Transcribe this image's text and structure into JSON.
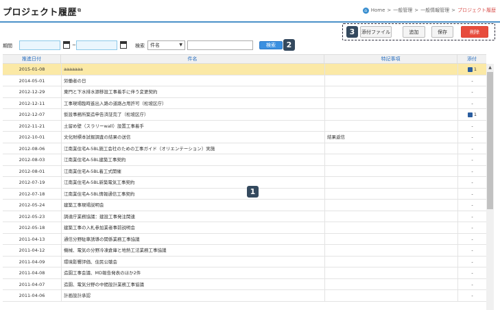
{
  "header": {
    "title": "プロジェクト履歴",
    "title_icon": "external-link-icon",
    "breadcrumb": {
      "home": "Home",
      "sep": ">",
      "items": [
        "一般管理",
        "一般情報管理"
      ],
      "current": "プロジェクト履歴"
    }
  },
  "toolbar": {
    "attach_label": "添付ファイル",
    "add_label": "追加",
    "save_label": "保存",
    "delete_label": "削除",
    "delete_color": "#e74c3c"
  },
  "badges": {
    "b1": "1",
    "b2": "2",
    "b3": "3"
  },
  "filter": {
    "period_label": "期間",
    "period_sep": "~",
    "search_label": "検索",
    "select_value": "件名",
    "search_button": "検索",
    "text_value": ""
  },
  "table": {
    "headers": [
      "推進日付",
      "件名",
      "特記事項",
      "添付"
    ],
    "rows": [
      {
        "date": "2015-01-08",
        "name": "aaaaaaa",
        "note": "",
        "att": "1",
        "selected": true
      },
      {
        "date": "2014-05-01",
        "name": "労働者の日",
        "note": "",
        "att": "-"
      },
      {
        "date": "2012-12-29",
        "name": "東門と下水排水源移設工事着手に伴う変更契約",
        "note": "",
        "att": "-"
      },
      {
        "date": "2012-12-11",
        "name": "工事現場臨時進出入路の道路占用許可（松坡区庁）",
        "note": "",
        "att": "-"
      },
      {
        "date": "2012-12-07",
        "name": "仮設事務所築造申告済証完了（松坡区庁）",
        "note": "",
        "att": "1"
      },
      {
        "date": "2012-11-21",
        "name": "土留め壁（スラリーwall）設置工事着手",
        "note": "",
        "att": "-"
      },
      {
        "date": "2012-10-01",
        "name": "文化財標本試掘調査の結果の送信",
        "note": "結果返信",
        "att": "-"
      },
      {
        "date": "2012-08-06",
        "name": "江南業住宅A-5BL施工会社のための工事ガイド（オリエンテーション）実施",
        "note": "",
        "att": "-"
      },
      {
        "date": "2012-08-03",
        "name": "江南業住宅A-5BL建築工事契約",
        "note": "",
        "att": "-"
      },
      {
        "date": "2012-08-01",
        "name": "江南業住宅A-5BL着工式開催",
        "note": "",
        "att": "-"
      },
      {
        "date": "2012-07-19",
        "name": "江南業住宅A-5BL新築電気工事契約",
        "note": "",
        "att": "-"
      },
      {
        "date": "2012-07-18",
        "name": "江南業住宅A-5BL情報通信工事契約",
        "note": "",
        "att": "-"
      },
      {
        "date": "2012-05-24",
        "name": "建築工事現場説明会",
        "note": "",
        "att": "-"
      },
      {
        "date": "2012-05-23",
        "name": "調達庁業務協議：建設工事発注関連",
        "note": "",
        "att": "-"
      },
      {
        "date": "2012-05-18",
        "name": "建築工事の入札参加業者事前説明会",
        "note": "",
        "att": "-"
      },
      {
        "date": "2011-04-13",
        "name": "通信分野駐車誘導の関係業務工事協議",
        "note": "",
        "att": "-"
      },
      {
        "date": "2011-04-12",
        "name": "機械、電気の分野冷凍倉庫と地熱工法業務工事協議",
        "note": "",
        "att": "-"
      },
      {
        "date": "2011-04-09",
        "name": "環境影響評価、住民公聴会",
        "note": "",
        "att": "-"
      },
      {
        "date": "2011-04-08",
        "name": "造園工事会議、MD報告発表のほか2件",
        "note": "",
        "att": "-"
      },
      {
        "date": "2011-04-07",
        "name": "造園、電気分野の中間設計業務工事協議",
        "note": "",
        "att": "-"
      },
      {
        "date": "2011-04-06",
        "name": "計画設計承認",
        "note": "",
        "att": "-"
      }
    ]
  }
}
